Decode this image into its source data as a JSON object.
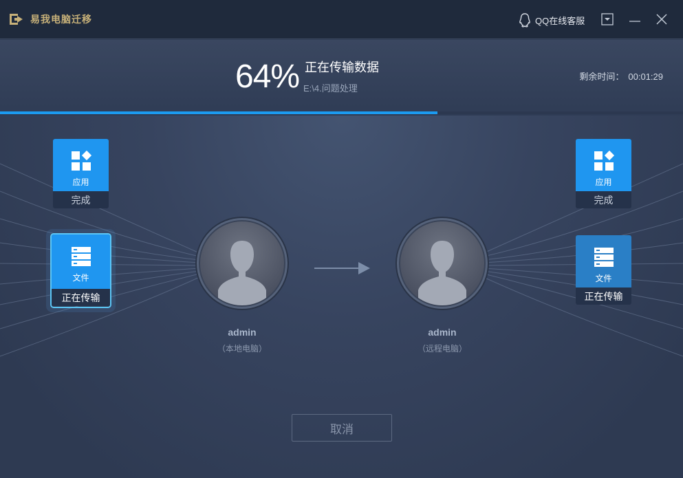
{
  "app": {
    "title": "易我电脑迁移"
  },
  "titlebar": {
    "qq_label": "QQ在线客服",
    "icons": [
      "logo-icon",
      "qq-penguin-icon",
      "dropdown-icon",
      "minimize-icon",
      "close-icon"
    ]
  },
  "progress": {
    "percent_text": "64%",
    "percent_value": 64,
    "status": "正在传输数据",
    "current_path": "E:\\4.问题处理",
    "remaining_label": "剩余时间：",
    "remaining_time": "00:01:29"
  },
  "left_tiles": [
    {
      "label": "应用",
      "status": "完成",
      "icon": "apps-icon"
    },
    {
      "label": "文件",
      "status": "正在传输",
      "icon": "files-icon"
    }
  ],
  "right_tiles": [
    {
      "label": "应用",
      "status": "完成",
      "icon": "apps-icon"
    },
    {
      "label": "文件",
      "status": "正在传输",
      "icon": "files-icon"
    }
  ],
  "local": {
    "name": "admin",
    "role": "（本地电脑）"
  },
  "remote": {
    "name": "admin",
    "role": "（远程电脑）"
  },
  "actions": {
    "cancel_label": "取消"
  },
  "colors": {
    "accent": "#1c9bf0",
    "tile_blue": "#1f96f0",
    "title_gold": "#c7b179",
    "background": "#2e3a52"
  }
}
